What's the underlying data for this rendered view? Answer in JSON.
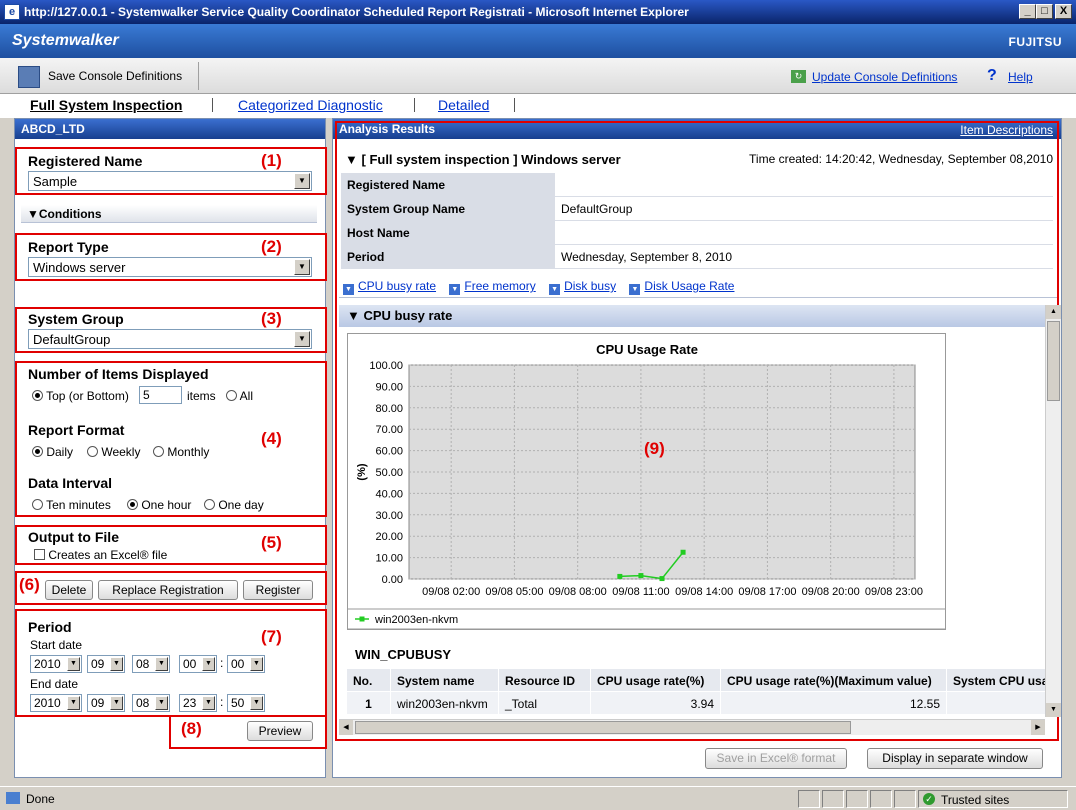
{
  "window": {
    "title": "http://127.0.0.1 - Systemwalker Service Quality Coordinator Scheduled Report Registrati - Microsoft Internet Explorer",
    "min": "_",
    "max": "□",
    "close": "X"
  },
  "brand": {
    "logo": "Systemwalker",
    "vendor": "FUJITSU"
  },
  "toolbar": {
    "save_console": "Save Console Definitions",
    "update_console": "Update Console Definitions",
    "help": "Help"
  },
  "tabs": [
    {
      "label": "Full System Inspection",
      "active": true
    },
    {
      "label": "Categorized Diagnostic",
      "active": false
    },
    {
      "label": "Detailed",
      "active": false
    }
  ],
  "left": {
    "header": "ABCD_LTD",
    "registered_name": {
      "label": "Registered Name",
      "value": "Sample",
      "marker": "(1)"
    },
    "conditions": "Conditions",
    "report_type": {
      "label": "Report Type",
      "value": "Windows server",
      "marker": "(2)"
    },
    "system_group": {
      "label": "System Group",
      "value": "DefaultGroup",
      "marker": "(3)"
    },
    "display": {
      "marker": "(4)",
      "items_label": "Number of Items Displayed",
      "top_label": "Top (or Bottom)",
      "top_value": "5",
      "items_word": "items",
      "all_label": "All",
      "format_label": "Report Format",
      "daily": "Daily",
      "weekly": "Weekly",
      "monthly": "Monthly",
      "interval_label": "Data Interval",
      "ten_minutes": "Ten minutes",
      "one_hour": "One hour",
      "one_day": "One day"
    },
    "output": {
      "marker": "(5)",
      "label": "Output to File",
      "checkbox": "Creates an Excel® file"
    },
    "buttons": {
      "marker": "(6)",
      "delete": "Delete",
      "replace": "Replace Registration",
      "register": "Register"
    },
    "period": {
      "marker": "(7)",
      "label": "Period",
      "start_label": "Start date",
      "start": {
        "year": "2010",
        "month": "09",
        "day": "08",
        "hour": "00",
        "minute": "00"
      },
      "end_label": "End date",
      "end": {
        "year": "2010",
        "month": "09",
        "day": "08",
        "hour": "23",
        "minute": "50"
      },
      "colon": ":"
    },
    "preview": {
      "marker": "(8)",
      "label": "Preview"
    }
  },
  "right": {
    "header": "Analysis Results",
    "item_descriptions": "Item Descriptions",
    "section_title": "[ Full system inspection ] Windows server",
    "time_created": "Time created: 14:20:42, Wednesday, September 08,2010",
    "info": [
      {
        "key": "Registered Name",
        "value": ""
      },
      {
        "key": "System Group Name",
        "value": "DefaultGroup"
      },
      {
        "key": "Host Name",
        "value": ""
      },
      {
        "key": "Period",
        "value": "Wednesday, September 8, 2010"
      }
    ],
    "anchors": [
      "CPU busy rate",
      "Free memory",
      "Disk busy",
      "Disk Usage Rate"
    ],
    "cpu_section": "CPU busy rate",
    "marker": "(9)",
    "table_title": "WIN_CPUBUSY",
    "columns": [
      "No.",
      "System name",
      "Resource ID",
      "CPU usage rate(%)",
      "CPU usage rate(%)(Maximum value)",
      "System CPU usa"
    ],
    "rows": [
      [
        "1",
        "win2003en-nkvm",
        "_Total",
        "3.94",
        "12.55",
        ""
      ]
    ],
    "save_excel": "Save in Excel® format",
    "separate_window": "Display in separate window"
  },
  "chart_data": {
    "type": "line",
    "title": "CPU Usage Rate",
    "ylabel": "(%)",
    "xlabel": "",
    "ylim": [
      0,
      100
    ],
    "yticks": [
      "100.00",
      "90.00",
      "80.00",
      "70.00",
      "60.00",
      "50.00",
      "40.00",
      "30.00",
      "20.00",
      "10.00",
      "0.00"
    ],
    "categories": [
      "09/08 02:00",
      "09/08 05:00",
      "09/08 08:00",
      "09/08 11:00",
      "09/08 14:00",
      "09/08 17:00",
      "09/08 20:00",
      "09/08 23:00"
    ],
    "series": [
      {
        "name": "win2003en-nkvm",
        "color": "#22cc22",
        "points": [
          [
            10.0,
            1.2
          ],
          [
            11.0,
            1.6
          ],
          [
            12.0,
            0.2
          ],
          [
            13.0,
            12.5
          ]
        ]
      }
    ],
    "xrange": [
      0,
      24
    ],
    "grid": true,
    "legend": "bottom-left"
  },
  "status": {
    "text": "Done",
    "zone": "Trusted sites"
  }
}
